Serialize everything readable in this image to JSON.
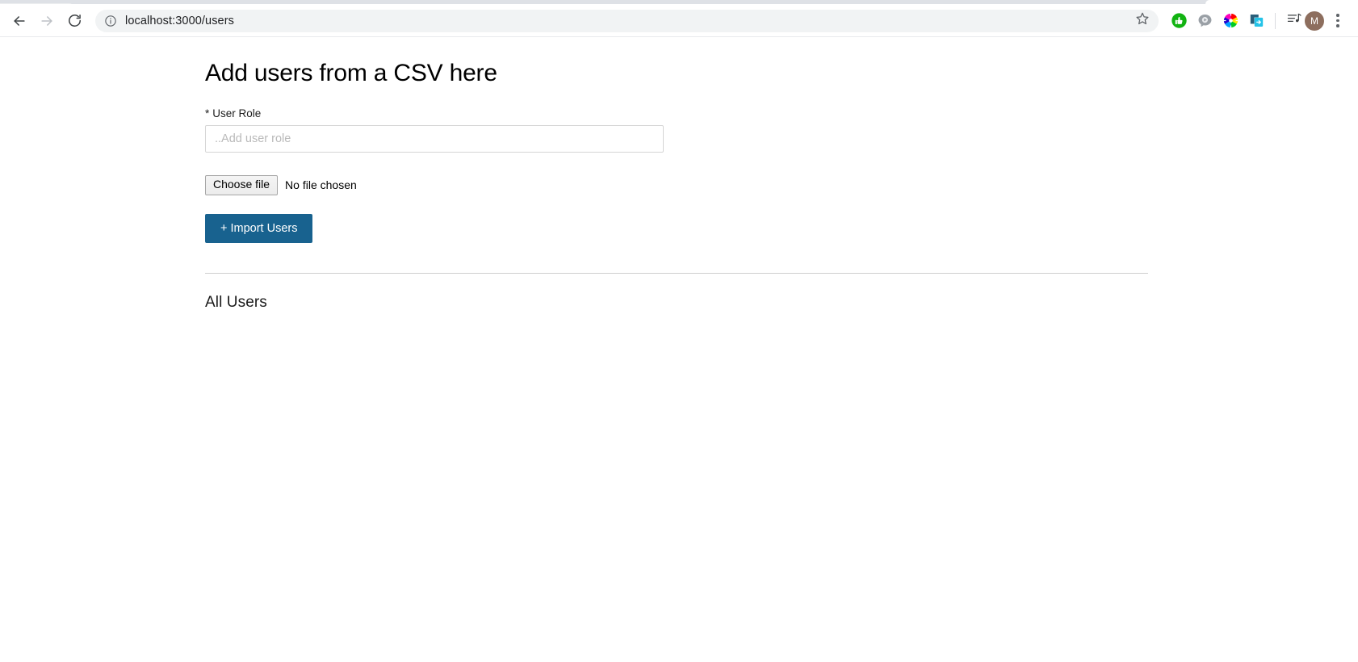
{
  "browser": {
    "back_label": "Back",
    "forward_label": "Forward",
    "reload_label": "Reload",
    "info_icon_label": "Site information",
    "url_host": "localhost:3000",
    "url_path": "/users",
    "url_full": "localhost:3000/users",
    "bookmark_label": "Bookmark this tab",
    "extensions": [
      {
        "name": "green-thumbs-up-extension",
        "color": "#12b312"
      },
      {
        "name": "speech-bubble-extension",
        "color": "#9aa0a6"
      },
      {
        "name": "color-wheel-extension",
        "color": "#ff0099"
      },
      {
        "name": "screen-share-extension",
        "color": "#25c3e8"
      }
    ],
    "media_icon_label": "Media controls",
    "profile_initial": "M",
    "menu_label": "Customize and control Chrome"
  },
  "page": {
    "title": "Add users from a CSV here",
    "form": {
      "role_required_marker": "*",
      "role_label": "User Role",
      "role_value": "",
      "role_placeholder": "..Add user role",
      "choose_file_label": "Choose file",
      "file_status": "No file chosen",
      "import_button_label": "+ Import Users",
      "import_button_color": "#18628f"
    },
    "section_title": "All Users"
  }
}
